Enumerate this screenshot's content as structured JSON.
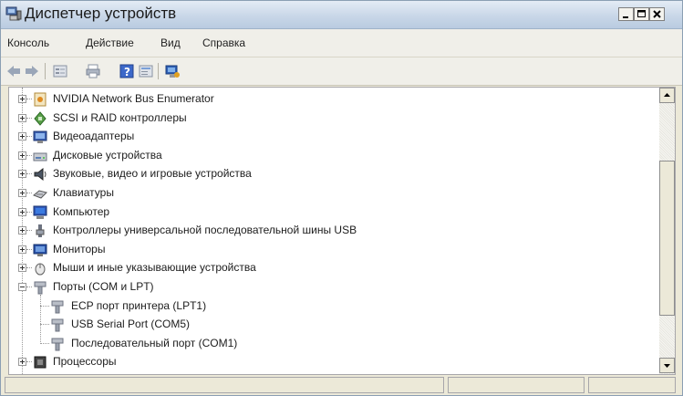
{
  "window": {
    "title": "Диспетчер устройств",
    "icon": "device-manager-icon",
    "controls": [
      "minimize",
      "maximize",
      "close"
    ]
  },
  "menu": [
    "Консоль",
    "Действие",
    "Вид",
    "Справка"
  ],
  "toolbar": [
    "back-arrow-icon",
    "forward-arrow-icon",
    "properties-icon",
    "print-icon",
    "help-icon",
    "view-icon",
    "scan-hardware-icon"
  ],
  "tree": [
    {
      "label": "NVIDIA Network Bus Enumerator",
      "icon": "bus-enumerator-icon",
      "expanded": false
    },
    {
      "label": "SCSI и RAID контроллеры",
      "icon": "scsi-controller-icon",
      "expanded": false
    },
    {
      "label": "Видеоадаптеры",
      "icon": "display-adapter-icon",
      "expanded": false
    },
    {
      "label": "Дисковые устройства",
      "icon": "disk-drive-icon",
      "expanded": false
    },
    {
      "label": "Звуковые, видео и игровые устройства",
      "icon": "sound-device-icon",
      "expanded": false
    },
    {
      "label": "Клавиатуры",
      "icon": "keyboard-icon",
      "expanded": false
    },
    {
      "label": "Компьютер",
      "icon": "computer-icon",
      "expanded": false
    },
    {
      "label": "Контроллеры универсальной последовательной шины USB",
      "icon": "usb-controller-icon",
      "expanded": false
    },
    {
      "label": "Мониторы",
      "icon": "monitor-icon",
      "expanded": false
    },
    {
      "label": "Мыши и иные указывающие устройства",
      "icon": "mouse-icon",
      "expanded": false
    },
    {
      "label": "Порты (COM и LPT)",
      "icon": "port-icon",
      "expanded": true,
      "children": [
        {
          "label": "ECP порт принтера (LPT1)",
          "icon": "port-icon"
        },
        {
          "label": "USB Serial Port (COM5)",
          "icon": "port-icon"
        },
        {
          "label": "Последовательный порт (COM1)",
          "icon": "port-icon"
        }
      ]
    },
    {
      "label": "Процессоры",
      "icon": "processor-icon",
      "expanded": false
    }
  ],
  "colors": {
    "title_gradient_top": "#e4ecf5",
    "title_gradient_bottom": "#b9cbe0",
    "chrome": "#ece9d8"
  }
}
